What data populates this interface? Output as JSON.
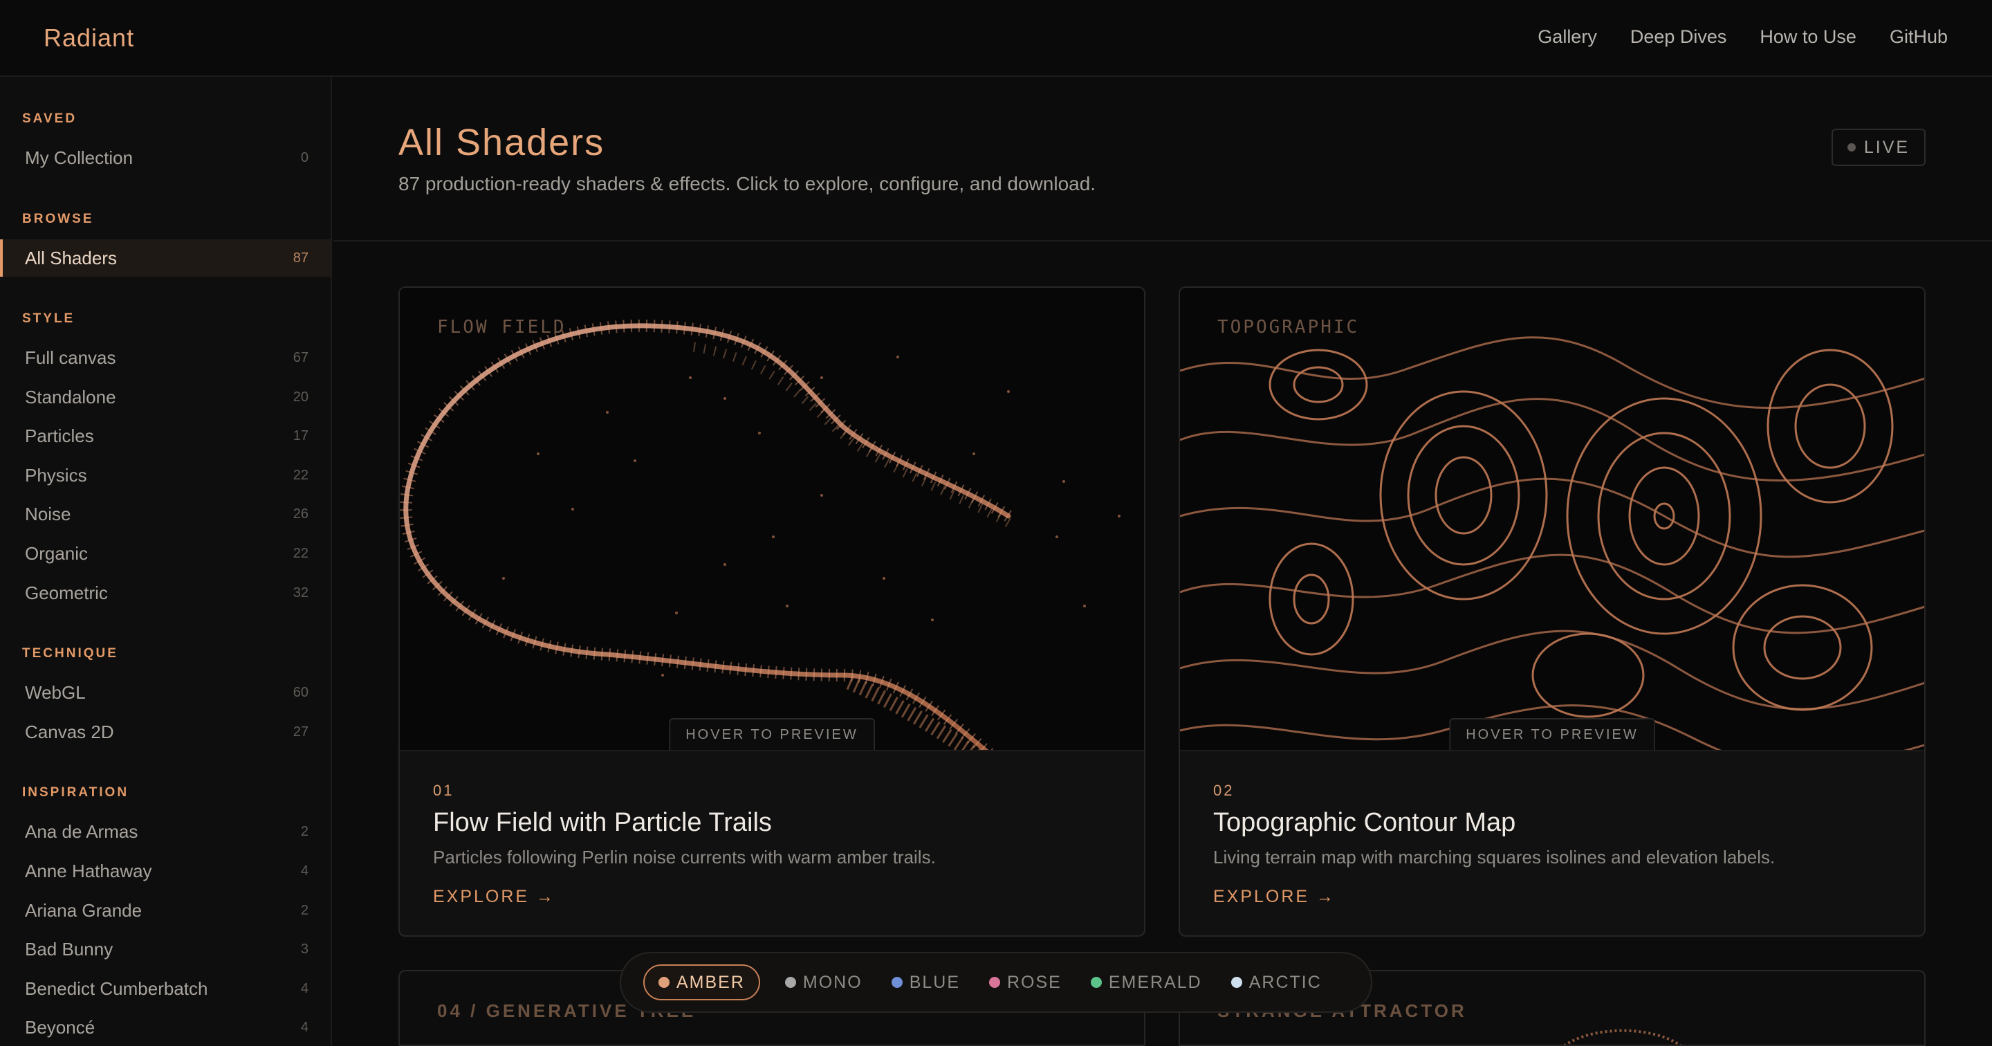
{
  "app": {
    "brand": "Radiant"
  },
  "nav": [
    "Gallery",
    "Deep Dives",
    "How to Use",
    "GitHub"
  ],
  "sidebar": {
    "sections": [
      {
        "label": "SAVED",
        "items": [
          {
            "label": "My Collection",
            "count": "0"
          }
        ]
      },
      {
        "label": "BROWSE",
        "items": [
          {
            "label": "All Shaders",
            "count": "87",
            "active": true
          }
        ]
      },
      {
        "label": "STYLE",
        "items": [
          {
            "label": "Full canvas",
            "count": "67"
          },
          {
            "label": "Standalone",
            "count": "20"
          },
          {
            "label": "Particles",
            "count": "17"
          },
          {
            "label": "Physics",
            "count": "22"
          },
          {
            "label": "Noise",
            "count": "26"
          },
          {
            "label": "Organic",
            "count": "22"
          },
          {
            "label": "Geometric",
            "count": "32"
          }
        ]
      },
      {
        "label": "TECHNIQUE",
        "items": [
          {
            "label": "WebGL",
            "count": "60"
          },
          {
            "label": "Canvas 2D",
            "count": "27"
          }
        ]
      },
      {
        "label": "INSPIRATION",
        "items": [
          {
            "label": "Ana de Armas",
            "count": "2"
          },
          {
            "label": "Anne Hathaway",
            "count": "4"
          },
          {
            "label": "Ariana Grande",
            "count": "2"
          },
          {
            "label": "Bad Bunny",
            "count": "3"
          },
          {
            "label": "Benedict Cumberbatch",
            "count": "4"
          },
          {
            "label": "Beyoncé",
            "count": "4"
          }
        ]
      }
    ]
  },
  "header": {
    "title": "All Shaders",
    "subtitle": "87 production-ready shaders & effects. Click to explore, configure, and download.",
    "live_label": "LIVE"
  },
  "cards": [
    {
      "overlay": "FLOW FIELD",
      "hover": "HOVER TO PREVIEW",
      "num": "01",
      "title": "Flow Field with Particle Trails",
      "desc": "Particles following Perlin noise currents with warm amber trails.",
      "explore": "EXPLORE →"
    },
    {
      "overlay": "TOPOGRAPHIC",
      "hover": "HOVER TO PREVIEW",
      "num": "02",
      "title": "Topographic Contour Map",
      "desc": "Living terrain map with marching squares isolines and elevation labels.",
      "explore": "EXPLORE →"
    }
  ],
  "partial_cards": [
    "04 / GENERATIVE TREE",
    "STRANGE ATTRACTOR"
  ],
  "themes": [
    {
      "label": "AMBER",
      "color": "#e0a07a",
      "active": true
    },
    {
      "label": "MONO",
      "color": "#a8a8a8"
    },
    {
      "label": "BLUE",
      "color": "#6f8fd6"
    },
    {
      "label": "ROSE",
      "color": "#d97598"
    },
    {
      "label": "EMERALD",
      "color": "#5cc48a"
    },
    {
      "label": "ARCTIC",
      "color": "#cfe0ee"
    }
  ],
  "colors": {
    "accent": "#e39a68",
    "background": "#0c0c0c"
  }
}
